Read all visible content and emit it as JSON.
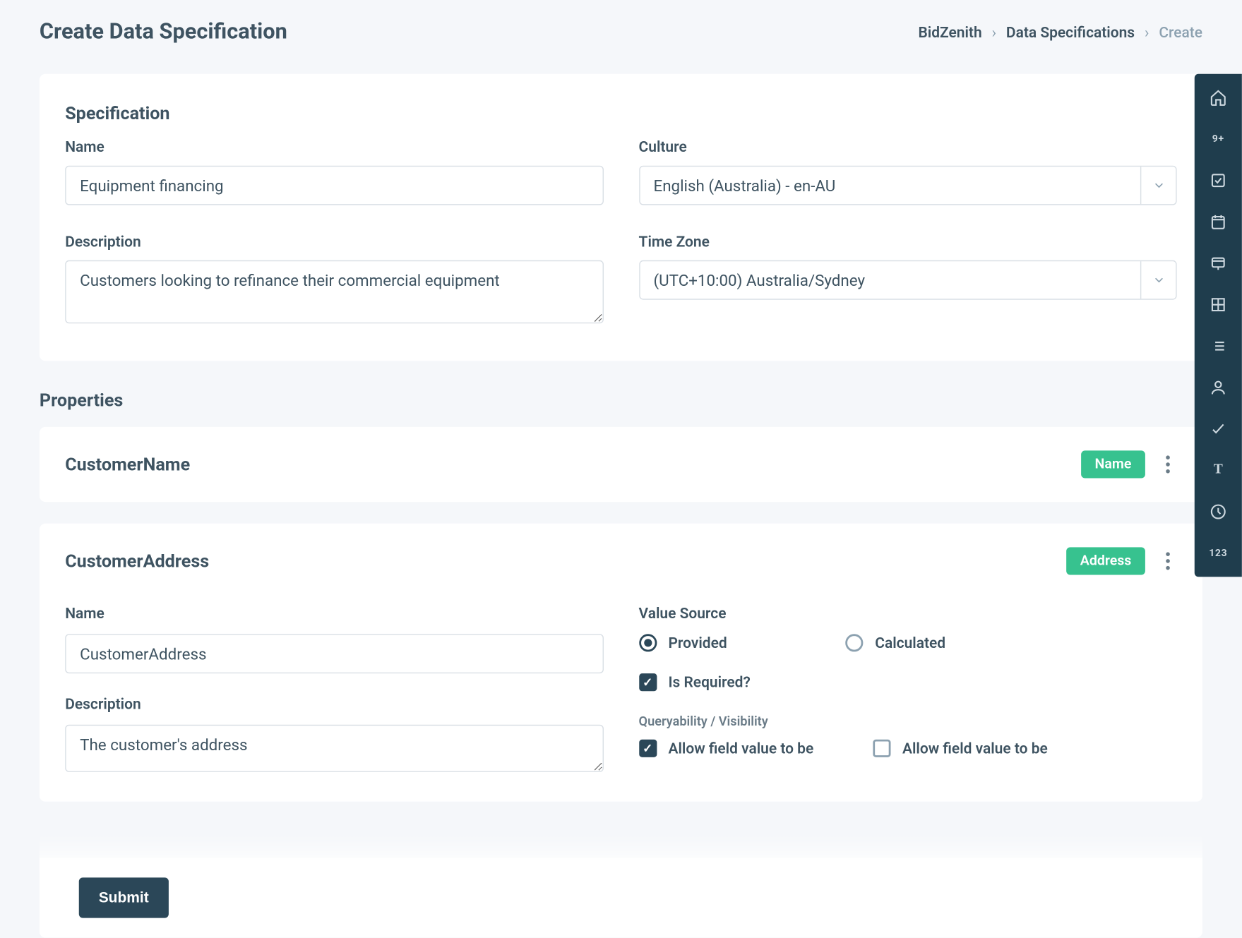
{
  "header": {
    "title": "Create Data Specification",
    "breadcrumbs": [
      "BidZenith",
      "Data Specifications",
      "Create"
    ]
  },
  "spec": {
    "section_title": "Specification",
    "name_label": "Name",
    "name_value": "Equipment financing",
    "culture_label": "Culture",
    "culture_value": "English (Australia) - en-AU",
    "desc_label": "Description",
    "desc_value": "Customers looking to refinance their commercial equipment",
    "tz_label": "Time Zone",
    "tz_value": "(UTC+10:00) Australia/Sydney"
  },
  "properties_title": "Properties",
  "properties": [
    {
      "name": "CustomerName",
      "badge": "Name"
    },
    {
      "name": "CustomerAddress",
      "badge": "Address"
    }
  ],
  "prop_detail": {
    "name_label": "Name",
    "name_value": "CustomerAddress",
    "desc_label": "Description",
    "desc_value": "The customer's address",
    "vs_label": "Value Source",
    "vs_opts": {
      "provided": "Provided",
      "calculated": "Calculated"
    },
    "vs_selected": "provided",
    "required_label": "Is Required?",
    "required_checked": true,
    "qv_label": "Queryability / Visibility",
    "queryable_label": "Allow field value to be",
    "queryable_checked": true,
    "publicly_label": "Allow field value to be",
    "publicly_checked": false
  },
  "footer": {
    "submit": "Submit"
  },
  "rail": [
    {
      "name": "home-icon"
    },
    {
      "name": "badge-icon",
      "text": "9+"
    },
    {
      "name": "checkbox-icon"
    },
    {
      "name": "calendar-icon"
    },
    {
      "name": "presentation-icon"
    },
    {
      "name": "table-icon"
    },
    {
      "name": "list-icon"
    },
    {
      "name": "person-icon"
    },
    {
      "name": "check-icon"
    },
    {
      "name": "text-icon",
      "text": "T"
    },
    {
      "name": "clock-icon"
    },
    {
      "name": "number-icon",
      "text": "123"
    }
  ]
}
